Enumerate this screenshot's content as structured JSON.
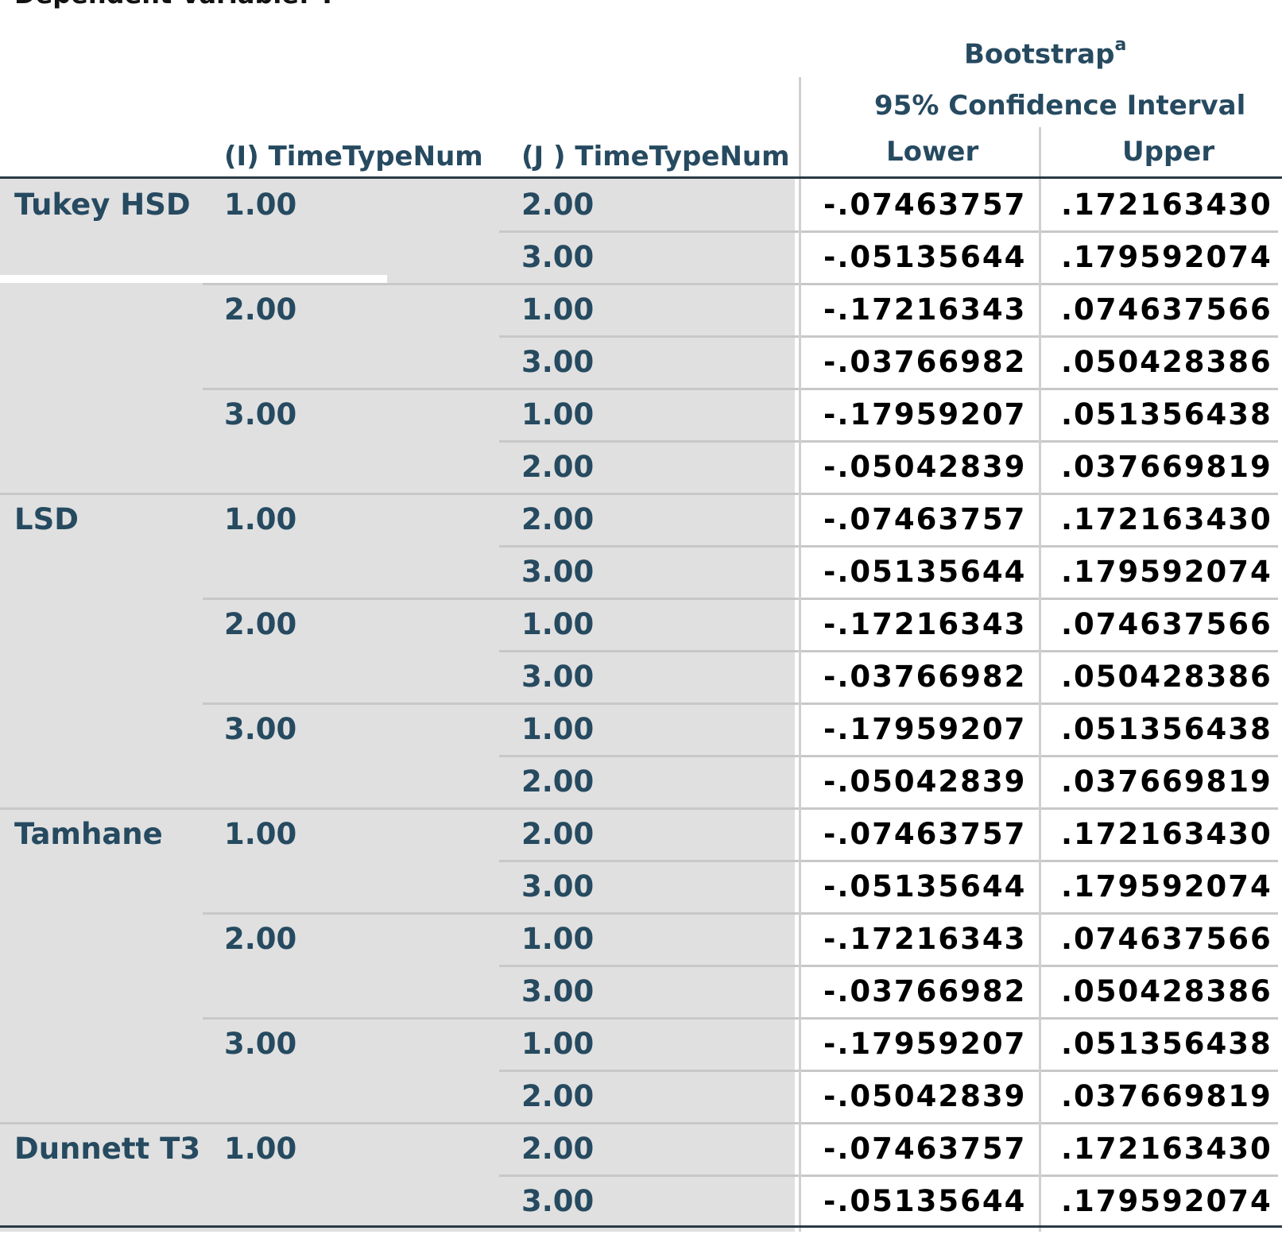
{
  "dependent_variable_title": "Dependent Variable:   Y",
  "headers": {
    "bootstrap": "Bootstrap",
    "bootstrap_footnote": "a",
    "confidence_interval": "95% Confidence Interval",
    "i_column": "(I) TimeTypeNum",
    "j_column": "(J ) TimeTypeNum",
    "lower": "Lower",
    "upper": "Upper"
  },
  "rows": [
    {
      "method": "Tukey HSD",
      "i": "1.00",
      "j": "2.00",
      "lower": "-.07463757",
      "upper": ".172163430"
    },
    {
      "method": "",
      "i": "",
      "j": "3.00",
      "lower": "-.05135644",
      "upper": ".179592074"
    },
    {
      "method": "",
      "i": "2.00",
      "j": "1.00",
      "lower": "-.17216343",
      "upper": ".074637566"
    },
    {
      "method": "",
      "i": "",
      "j": "3.00",
      "lower": "-.03766982",
      "upper": ".050428386"
    },
    {
      "method": "",
      "i": "3.00",
      "j": "1.00",
      "lower": "-.17959207",
      "upper": ".051356438"
    },
    {
      "method": "",
      "i": "",
      "j": "2.00",
      "lower": "-.05042839",
      "upper": ".037669819"
    },
    {
      "method": "LSD",
      "i": "1.00",
      "j": "2.00",
      "lower": "-.07463757",
      "upper": ".172163430"
    },
    {
      "method": "",
      "i": "",
      "j": "3.00",
      "lower": "-.05135644",
      "upper": ".179592074"
    },
    {
      "method": "",
      "i": "2.00",
      "j": "1.00",
      "lower": "-.17216343",
      "upper": ".074637566"
    },
    {
      "method": "",
      "i": "",
      "j": "3.00",
      "lower": "-.03766982",
      "upper": ".050428386"
    },
    {
      "method": "",
      "i": "3.00",
      "j": "1.00",
      "lower": "-.17959207",
      "upper": ".051356438"
    },
    {
      "method": "",
      "i": "",
      "j": "2.00",
      "lower": "-.05042839",
      "upper": ".037669819"
    },
    {
      "method": "Tamhane",
      "i": "1.00",
      "j": "2.00",
      "lower": "-.07463757",
      "upper": ".172163430"
    },
    {
      "method": "",
      "i": "",
      "j": "3.00",
      "lower": "-.05135644",
      "upper": ".179592074"
    },
    {
      "method": "",
      "i": "2.00",
      "j": "1.00",
      "lower": "-.17216343",
      "upper": ".074637566"
    },
    {
      "method": "",
      "i": "",
      "j": "3.00",
      "lower": "-.03766982",
      "upper": ".050428386"
    },
    {
      "method": "",
      "i": "3.00",
      "j": "1.00",
      "lower": "-.17959207",
      "upper": ".051356438"
    },
    {
      "method": "",
      "i": "",
      "j": "2.00",
      "lower": "-.05042839",
      "upper": ".037669819"
    },
    {
      "method": "Dunnett T3",
      "i": "1.00",
      "j": "2.00",
      "lower": "-.07463757",
      "upper": ".172163430"
    },
    {
      "method": "",
      "i": "",
      "j": "3.00",
      "lower": "-.05135644",
      "upper": ".179592074"
    }
  ]
}
